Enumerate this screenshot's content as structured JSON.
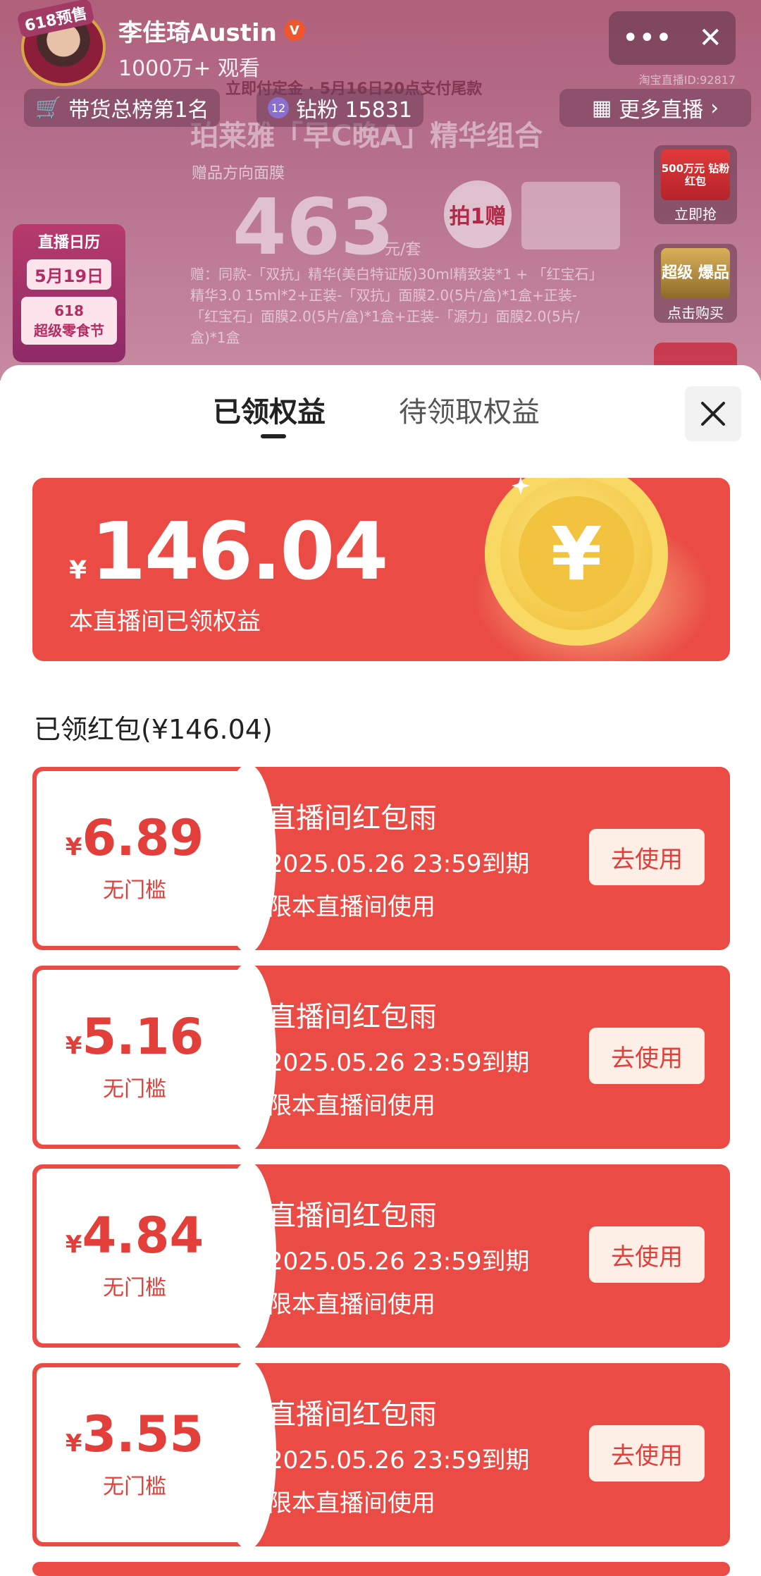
{
  "host": {
    "name": "李佳琦Austin",
    "viewers": "1000万+ 观看",
    "avatar_badge": "618预售",
    "verified_mark": "V"
  },
  "top_actions": {
    "more_icon": "•••",
    "close_icon": "✕"
  },
  "room_id": "淘宝直播ID:92817",
  "badges": {
    "rank": "带货总榜第1名",
    "fans": "钻粉 15831",
    "fan_level": "12",
    "more_live": "更多直播"
  },
  "promo": {
    "strip": "立即付定金 · 5月16日20点支付尾款",
    "title": "珀莱雅「早C晚A」精华组合",
    "sub": "赠品方向面膜",
    "price": "463",
    "unit": "元/套",
    "badge": "拍1赠",
    "gift": "赠：同款-「双抗」精华(美白特证版)30ml精致装*1 + 「红宝石」精华3.0 15ml*2+正装-「双抗」面膜2.0(5片/盒)*1盒+正装-「红宝石」面膜2.0(5片/盒)*1盒+正装-「源力」面膜2.0(5片/盒)*1盒"
  },
  "calendar": {
    "title": "直播日历",
    "date": "5月19日",
    "event_line1": "618",
    "event_line2": "超级零食节"
  },
  "side_cards": [
    {
      "thumb": "500万元 钻粉红包",
      "caption": "立即抢"
    },
    {
      "thumb": "超级 爆品",
      "caption": "点击购买"
    }
  ],
  "sheet": {
    "tabs": [
      {
        "label": "已领权益"
      },
      {
        "label": "待领取权益"
      }
    ],
    "close_icon": "✕",
    "summary": {
      "currency": "¥",
      "amount": "146.04",
      "label": "本直播间已领权益",
      "coin_symbol": "¥"
    },
    "section_title": "已领红包(¥146.04)",
    "coupons": [
      {
        "currency": "¥",
        "amount": "6.89",
        "threshold": "无门槛",
        "title": "直播间红包雨",
        "expiry": "2025.05.26 23:59到期",
        "scope": "限本直播间使用",
        "button": "去使用"
      },
      {
        "currency": "¥",
        "amount": "5.16",
        "threshold": "无门槛",
        "title": "直播间红包雨",
        "expiry": "2025.05.26 23:59到期",
        "scope": "限本直播间使用",
        "button": "去使用"
      },
      {
        "currency": "¥",
        "amount": "4.84",
        "threshold": "无门槛",
        "title": "直播间红包雨",
        "expiry": "2025.05.26 23:59到期",
        "scope": "限本直播间使用",
        "button": "去使用"
      },
      {
        "currency": "¥",
        "amount": "3.55",
        "threshold": "无门槛",
        "title": "直播间红包雨",
        "expiry": "2025.05.26 23:59到期",
        "scope": "限本直播间使用",
        "button": "去使用"
      }
    ]
  },
  "colors": {
    "accent": "#ea4b44",
    "coupon_text": "#e23f3a",
    "button_bg": "#fdeee6",
    "coin": "#f4c94a"
  }
}
